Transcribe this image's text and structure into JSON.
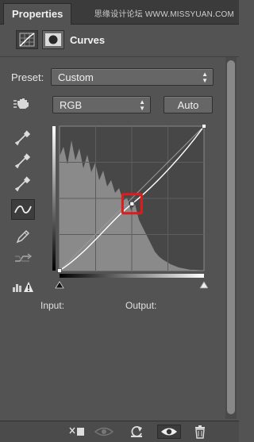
{
  "panel": {
    "tab_title": "Properties",
    "watermark": "思缘设计论坛 WWW.MISSYUAN.COM"
  },
  "header": {
    "title": "Curves"
  },
  "preset": {
    "label": "Preset:",
    "value": "Custom"
  },
  "channel": {
    "value": "RGB",
    "auto_label": "Auto"
  },
  "graph": {
    "input_label": "Input:",
    "output_label": "Output:",
    "highlight_color": "#e01b1b"
  },
  "chart_data": {
    "type": "line",
    "title": "",
    "xlabel": "Input:",
    "ylabel": "Output:",
    "xlim": [
      0,
      255
    ],
    "ylim": [
      0,
      255
    ],
    "grid": true,
    "series": [
      {
        "name": "",
        "x": [
          0,
          128,
          255
        ],
        "y": [
          0,
          118,
          255
        ]
      }
    ]
  },
  "tools": [
    "target-adjust-icon",
    "black-eyedropper-icon",
    "gray-eyedropper-icon",
    "white-eyedropper-icon",
    "curve-points-icon",
    "pencil-icon",
    "smooth-icon",
    "clipping-warning-icon"
  ],
  "bottom_icons": [
    "clip-to-layer-icon",
    "view-previous-icon",
    "reset-icon",
    "visibility-icon",
    "delete-icon"
  ]
}
